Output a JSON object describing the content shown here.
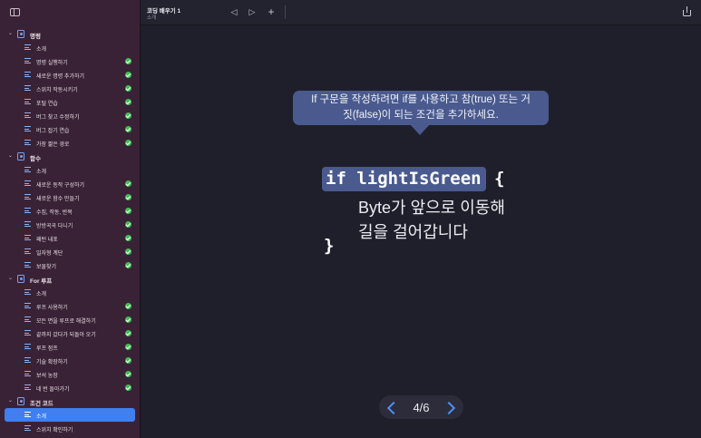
{
  "toolbar": {
    "title": "코딩 배우기 1",
    "subtitle": "소개",
    "back_icon": "triangle-left-icon",
    "forward_icon": "triangle-right-icon",
    "add_icon": "plus-icon",
    "share_icon": "share-icon"
  },
  "sidebar": {
    "sections": [
      {
        "label": "명령",
        "items": [
          {
            "label": "소개",
            "done": false
          },
          {
            "label": "명령 실행하기",
            "done": true
          },
          {
            "label": "새로운 명령 추가하기",
            "done": true
          },
          {
            "label": "스위치 작동시키기",
            "done": true
          },
          {
            "label": "포털 연습",
            "done": true
          },
          {
            "label": "버그 찾고 수정하기",
            "done": true
          },
          {
            "label": "버그 잡기 연습",
            "done": true
          },
          {
            "label": "가장 짧은 경로",
            "done": true
          }
        ]
      },
      {
        "label": "함수",
        "items": [
          {
            "label": "소개",
            "done": false
          },
          {
            "label": "새로운 동작 구성하기",
            "done": true
          },
          {
            "label": "새로운 함수 만들기",
            "done": true
          },
          {
            "label": "수집, 작동, 반복",
            "done": true
          },
          {
            "label": "방방곡곡 다니기",
            "done": true
          },
          {
            "label": "패턴 내포",
            "done": true
          },
          {
            "label": "일자형 계단",
            "done": true
          },
          {
            "label": "보물찾기",
            "done": true
          }
        ]
      },
      {
        "label": "For 루프",
        "items": [
          {
            "label": "소개",
            "done": false
          },
          {
            "label": "루프 사용하기",
            "done": true
          },
          {
            "label": "모든 면을 루프로 해결하기",
            "done": true
          },
          {
            "label": "끝까지 갔다가 되돌아 오기",
            "done": true
          },
          {
            "label": "루프 점프",
            "done": true
          },
          {
            "label": "기술 확장하기",
            "done": true
          },
          {
            "label": "보석 농장",
            "done": true
          },
          {
            "label": "네 번 돌아가기",
            "done": true
          }
        ]
      },
      {
        "label": "조건 코드",
        "items": [
          {
            "label": "소개",
            "done": false,
            "selected": true
          },
          {
            "label": "스위치 확인하기",
            "done": false
          }
        ]
      }
    ]
  },
  "content": {
    "callout_line1": "If 구문을 작성하려면 if를 사용하고 참(true) 또는 거",
    "callout_line2": "짓(false)이 되는 조건을 추가하세요.",
    "code_if": "if lightIsGreen",
    "brace_open": "{",
    "body_line1": "Byte가 앞으로 이동해",
    "body_line2": "길을 걸어갑니다",
    "brace_close": "}"
  },
  "pager": {
    "label": "4/6",
    "prev_icon": "chevron-left-icon",
    "next_icon": "chevron-right-icon"
  },
  "colors": {
    "sidebar_bg": "#3a2236",
    "main_bg": "#1f1f2b",
    "highlight": "#4a5a8e",
    "selected": "#3f7ff0",
    "check": "#3fbf55",
    "accent": "#4d8ff5"
  }
}
